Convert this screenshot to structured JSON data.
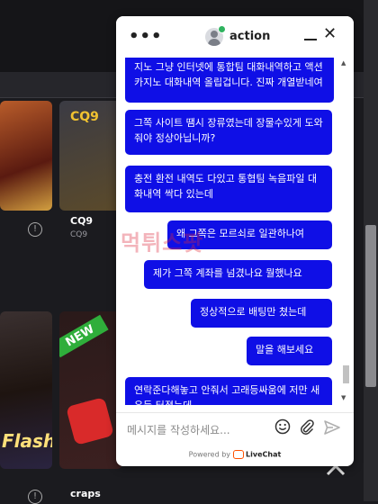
{
  "background": {
    "games": [
      {
        "name": "CQ9",
        "provider": "CQ9",
        "logo": "CQ9"
      },
      {
        "name": "craps",
        "provider": "",
        "badge": "NEW"
      },
      {
        "name": "",
        "banner": "Flash"
      }
    ]
  },
  "chat": {
    "agent_name": "action",
    "messages": [
      "지노 그냥 인터넷에 통합팀 대화내역하고 액션카지노 대화내역 올립겁니다. 진짜 개열받네여",
      "그쪽 사이트 땜시 장류였는데 장물수있게 도와줘야 정상아닙니까?",
      "충전 환전 내역도 다있고 통협팀 녹음파일 대화내역 싹다 있는데",
      "왜 그쪽은 모르쇠로 일관하나여",
      "제가 그쪽 계좌를 넘겼나요 뭘했나요",
      "정상적으로 배팅만 쳤는데",
      "말을 해보세요",
      "연락준다해놓고 안줘서 고래등싸움에 저만 새우등 터졌는데"
    ],
    "composer_placeholder": "메시지를 작성하세요...",
    "powered_prefix": "Powered by",
    "powered_brand": "LiveChat",
    "icons": [
      "more-icon",
      "avatar",
      "minimize-icon",
      "close-icon",
      "emoji-icon",
      "attach-icon",
      "send-icon"
    ],
    "bubble_color": "#0f0fe6"
  },
  "watermark": "먹튀스팟"
}
